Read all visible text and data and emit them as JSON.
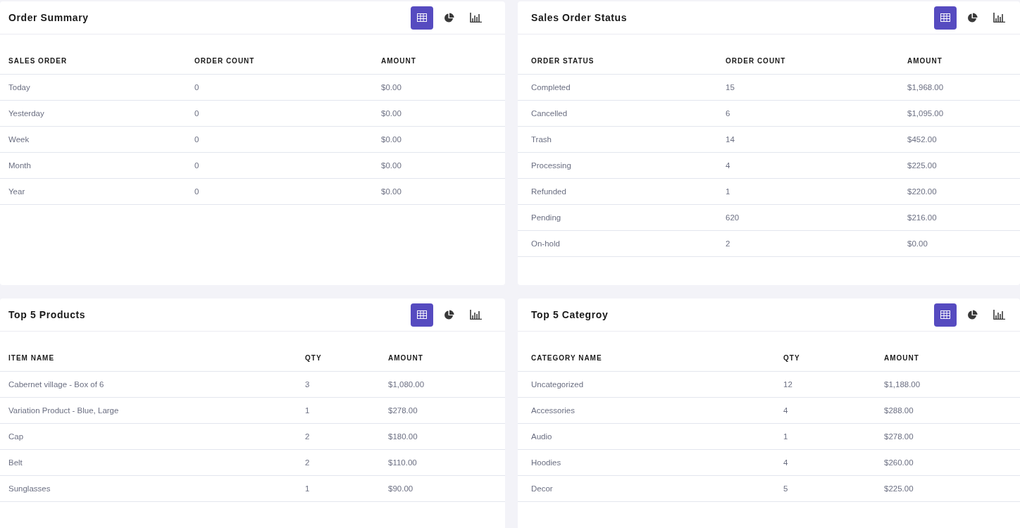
{
  "cards": [
    {
      "title": "Order Summary",
      "views": [
        {
          "kind": "table",
          "selected": true
        },
        {
          "kind": "pie",
          "selected": false
        },
        {
          "kind": "bar",
          "selected": false
        }
      ],
      "columns": [
        "SALES ORDER",
        "ORDER COUNT",
        "AMOUNT"
      ],
      "rows": [
        [
          "Today",
          "0",
          "$0.00"
        ],
        [
          "Yesterday",
          "0",
          "$0.00"
        ],
        [
          "Week",
          "0",
          "$0.00"
        ],
        [
          "Month",
          "0",
          "$0.00"
        ],
        [
          "Year",
          "0",
          "$0.00"
        ]
      ]
    },
    {
      "title": "Sales Order Status",
      "views": [
        {
          "kind": "table",
          "selected": true
        },
        {
          "kind": "pie",
          "selected": false
        },
        {
          "kind": "bar",
          "selected": false
        }
      ],
      "columns": [
        "ORDER STATUS",
        "ORDER COUNT",
        "AMOUNT"
      ],
      "rows": [
        [
          "Completed",
          "15",
          "$1,968.00"
        ],
        [
          "Cancelled",
          "6",
          "$1,095.00"
        ],
        [
          "Trash",
          "14",
          "$452.00"
        ],
        [
          "Processing",
          "4",
          "$225.00"
        ],
        [
          "Refunded",
          "1",
          "$220.00"
        ],
        [
          "Pending",
          "620",
          "$216.00"
        ],
        [
          "On-hold",
          "2",
          "$0.00"
        ]
      ]
    },
    {
      "title": "Top 5 Products",
      "views": [
        {
          "kind": "table",
          "selected": true
        },
        {
          "kind": "pie",
          "selected": false
        },
        {
          "kind": "bar",
          "selected": false
        }
      ],
      "columns": [
        "ITEM NAME",
        "QTY",
        "AMOUNT"
      ],
      "rows": [
        [
          "Cabernet village - Box of 6",
          "3",
          "$1,080.00"
        ],
        [
          "Variation Product - Blue, Large",
          "1",
          "$278.00"
        ],
        [
          "Cap",
          "2",
          "$180.00"
        ],
        [
          "Belt",
          "2",
          "$110.00"
        ],
        [
          "Sunglasses",
          "1",
          "$90.00"
        ]
      ]
    },
    {
      "title": "Top 5 Categroy",
      "views": [
        {
          "kind": "table",
          "selected": true
        },
        {
          "kind": "pie",
          "selected": false
        },
        {
          "kind": "bar",
          "selected": false
        }
      ],
      "columns": [
        "CATEGORY NAME",
        "QTY",
        "AMOUNT"
      ],
      "rows": [
        [
          "Uncategorized",
          "12",
          "$1,188.00"
        ],
        [
          "Accessories",
          "4",
          "$288.00"
        ],
        [
          "Audio",
          "1",
          "$278.00"
        ],
        [
          "Hoodies",
          "4",
          "$260.00"
        ],
        [
          "Decor",
          "5",
          "$225.00"
        ]
      ]
    }
  ]
}
